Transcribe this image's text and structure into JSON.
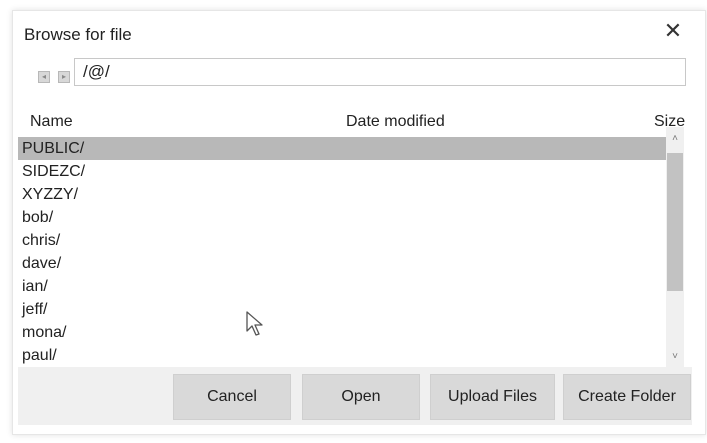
{
  "dialog": {
    "title": "Browse for file",
    "close_glyph": "✕"
  },
  "toolbar": {
    "path_value": "/@/",
    "nav_icons": [
      "back-icon",
      "forward-icon"
    ]
  },
  "columns": {
    "name": "Name",
    "date_modified": "Date modified",
    "size": "Size"
  },
  "files": [
    {
      "name": "PUBLIC/",
      "selected": true
    },
    {
      "name": "SIDEZC/",
      "selected": false
    },
    {
      "name": "XYZZY/",
      "selected": false
    },
    {
      "name": "bob/",
      "selected": false
    },
    {
      "name": "chris/",
      "selected": false
    },
    {
      "name": "dave/",
      "selected": false
    },
    {
      "name": "ian/",
      "selected": false
    },
    {
      "name": "jeff/",
      "selected": false
    },
    {
      "name": "mona/",
      "selected": false
    },
    {
      "name": "paul/",
      "selected": false
    }
  ],
  "scrollbar": {
    "up_glyph": "˄",
    "down_glyph": "˅"
  },
  "buttons": {
    "cancel": "Cancel",
    "open": "Open",
    "upload": "Upload Files",
    "create_folder": "Create Folder"
  },
  "colors": {
    "selected_row": "#b8b8b8",
    "button_bg": "#d9d9d9",
    "footer_bg": "#f0f0f0"
  }
}
